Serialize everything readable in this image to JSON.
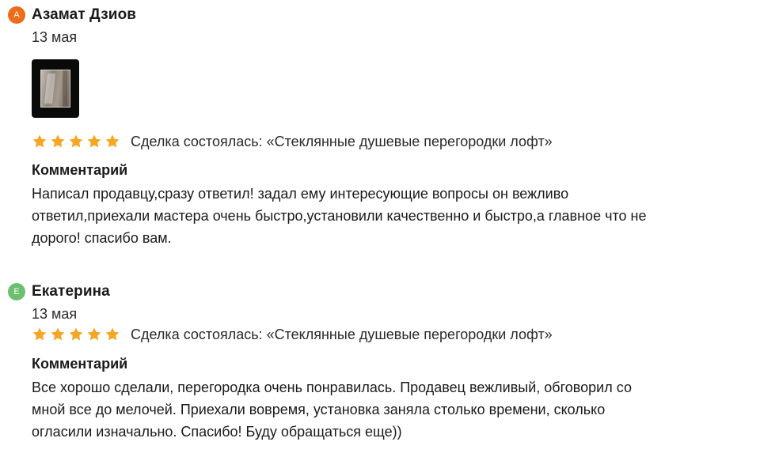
{
  "colors": {
    "avatar_1": "#ef6c1a",
    "avatar_2": "#6cbf6e",
    "star": "#f5a623"
  },
  "reviews": [
    {
      "avatar_letter": "А",
      "author": "Азамат Дзиов",
      "date": "13 мая",
      "has_photo": true,
      "rating": 5,
      "deal": "Сделка состоялась: «Стеклянные душевые перегородки лофт»",
      "comment_title": "Комментарий",
      "comment_lines": [
        "Написал продавцу,сразу ответил! задал ему интересующие вопросы он вежливо",
        "ответил,приехали мастера очень быстро,установили качественно и быстро,а главное что не",
        "дорого! спасибо вам."
      ]
    },
    {
      "avatar_letter": "Е",
      "author": "Екатерина",
      "date": "13 мая",
      "has_photo": false,
      "rating": 5,
      "deal": "Сделка состоялась: «Стеклянные душевые перегородки лофт»",
      "comment_title": "Комментарий",
      "comment_lines": [
        "Все хорошо сделали, перегородка очень понравилась. Продавец вежливый, обговорил со",
        "мной все до мелочей. Приехали вовремя, установка заняла столько времени, сколько",
        "огласили изначально. Спасибо! Буду обращаться еще))"
      ]
    }
  ]
}
